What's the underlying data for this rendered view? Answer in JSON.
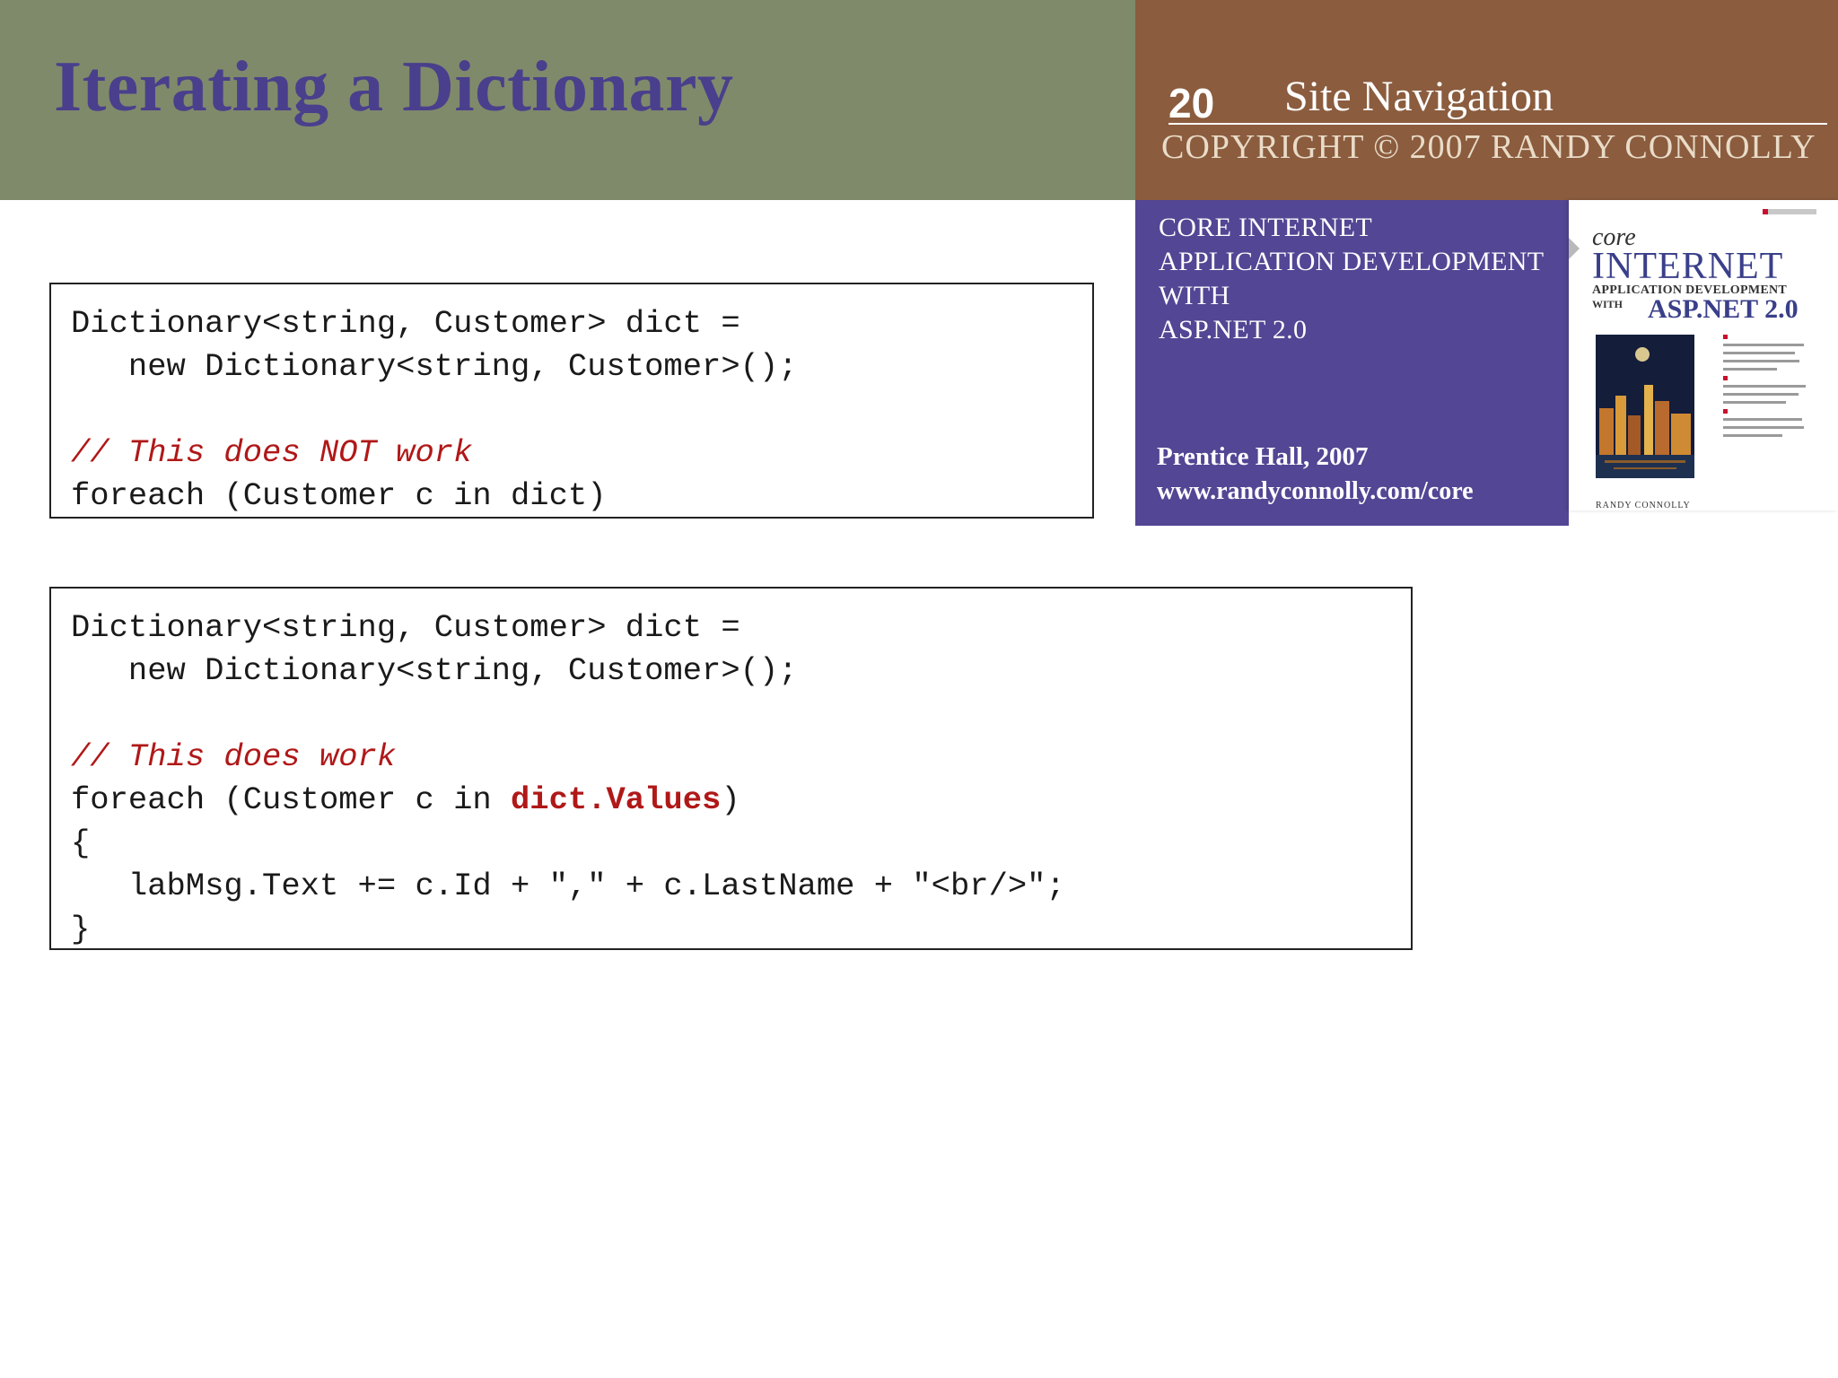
{
  "slide": {
    "title": "Iterating a Dictionary",
    "number": "20",
    "section": "Site Navigation",
    "copyright": "COPYRIGHT © 2007 RANDY CONNOLLY"
  },
  "book_panel": {
    "title_lines": [
      "CORE INTERNET",
      "APPLICATION DEVELOPMENT",
      "WITH",
      "ASP.NET 2.0"
    ],
    "publisher": "Prentice Hall, 2007",
    "url": "www.randyconnolly.com/core"
  },
  "book_cover": {
    "core": "core",
    "internet": "INTERNET",
    "appdev": "APPLICATION DEVELOPMENT",
    "with": "WITH",
    "aspnet": "ASP.NET 2.0",
    "author": "RANDY CONNOLLY"
  },
  "code1": {
    "line1": "Dictionary<string, Customer> dict =",
    "line2": "   new Dictionary<string, Customer>();",
    "comment": "// This does NOT work",
    "line4": "foreach (Customer c in dict)"
  },
  "code2": {
    "line1": "Dictionary<string, Customer> dict =",
    "line2": "   new Dictionary<string, Customer>();",
    "comment": "// This does work",
    "foreach_prefix": "foreach (Customer c in ",
    "foreach_highlight": "dict.Values",
    "foreach_suffix": ")",
    "open_brace": "{",
    "body": "   labMsg.Text += c.Id + \",\" + c.LastName + \"<br/>\";",
    "close_brace": "}"
  },
  "colors": {
    "title_bar": "#7f8a6b",
    "title_text": "#4a3f8c",
    "header_right": "#8b5c3e",
    "book_panel": "#534694",
    "code_highlight": "#b01818"
  }
}
